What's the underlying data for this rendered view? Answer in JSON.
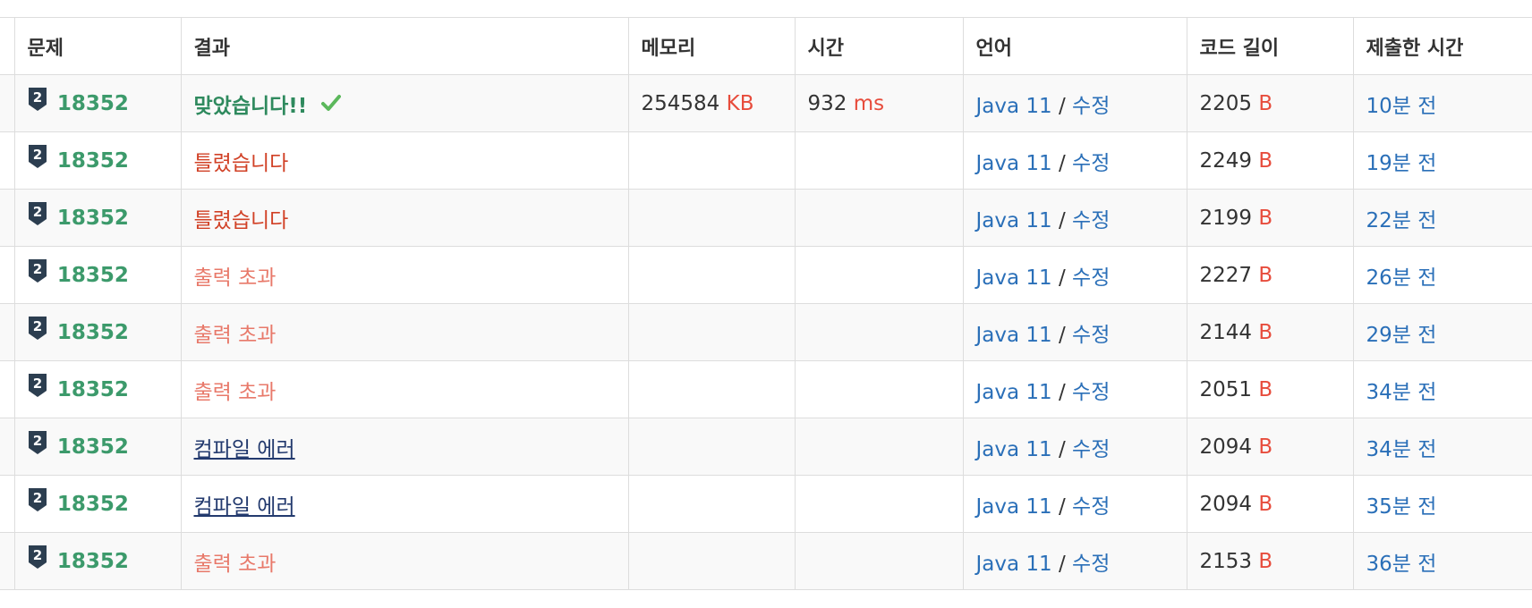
{
  "colors": {
    "ac": "#2f8a5e",
    "wa": "#d14126",
    "ole": "#e8796a",
    "ce": "#233a6e",
    "link": "#2a6fb8",
    "unit": "#e74c3c",
    "problem": "#3c9a6b",
    "tier_badge": "#2c3e50"
  },
  "headers": {
    "problem": "문제",
    "result": "결과",
    "memory": "메모리",
    "time": "시간",
    "language": "언어",
    "code_length": "코드 길이",
    "submitted": "제출한 시간"
  },
  "rows": [
    {
      "problem": "18352",
      "tier": "2",
      "result": "맞았습니다!!",
      "result_type": "ac",
      "memory": "254584",
      "memory_unit": "KB",
      "time": "932",
      "time_unit": "ms",
      "language": "Java 11",
      "slash": "/",
      "edit": "수정",
      "code_length": "2205",
      "code_unit": "B",
      "submitted": "10분 전"
    },
    {
      "problem": "18352",
      "tier": "2",
      "result": "틀렸습니다",
      "result_type": "wa",
      "memory": "",
      "memory_unit": "",
      "time": "",
      "time_unit": "",
      "language": "Java 11",
      "slash": "/",
      "edit": "수정",
      "code_length": "2249",
      "code_unit": "B",
      "submitted": "19분 전"
    },
    {
      "problem": "18352",
      "tier": "2",
      "result": "틀렸습니다",
      "result_type": "wa",
      "memory": "",
      "memory_unit": "",
      "time": "",
      "time_unit": "",
      "language": "Java 11",
      "slash": "/",
      "edit": "수정",
      "code_length": "2199",
      "code_unit": "B",
      "submitted": "22분 전"
    },
    {
      "problem": "18352",
      "tier": "2",
      "result": "출력 초과",
      "result_type": "ole",
      "memory": "",
      "memory_unit": "",
      "time": "",
      "time_unit": "",
      "language": "Java 11",
      "slash": "/",
      "edit": "수정",
      "code_length": "2227",
      "code_unit": "B",
      "submitted": "26분 전"
    },
    {
      "problem": "18352",
      "tier": "2",
      "result": "출력 초과",
      "result_type": "ole",
      "memory": "",
      "memory_unit": "",
      "time": "",
      "time_unit": "",
      "language": "Java 11",
      "slash": "/",
      "edit": "수정",
      "code_length": "2144",
      "code_unit": "B",
      "submitted": "29분 전"
    },
    {
      "problem": "18352",
      "tier": "2",
      "result": "출력 초과",
      "result_type": "ole",
      "memory": "",
      "memory_unit": "",
      "time": "",
      "time_unit": "",
      "language": "Java 11",
      "slash": "/",
      "edit": "수정",
      "code_length": "2051",
      "code_unit": "B",
      "submitted": "34분 전"
    },
    {
      "problem": "18352",
      "tier": "2",
      "result": "컴파일 에러",
      "result_type": "ce",
      "memory": "",
      "memory_unit": "",
      "time": "",
      "time_unit": "",
      "language": "Java 11",
      "slash": "/",
      "edit": "수정",
      "code_length": "2094",
      "code_unit": "B",
      "submitted": "34분 전"
    },
    {
      "problem": "18352",
      "tier": "2",
      "result": "컴파일 에러",
      "result_type": "ce",
      "memory": "",
      "memory_unit": "",
      "time": "",
      "time_unit": "",
      "language": "Java 11",
      "slash": "/",
      "edit": "수정",
      "code_length": "2094",
      "code_unit": "B",
      "submitted": "35분 전"
    },
    {
      "problem": "18352",
      "tier": "2",
      "result": "출력 초과",
      "result_type": "ole",
      "memory": "",
      "memory_unit": "",
      "time": "",
      "time_unit": "",
      "language": "Java 11",
      "slash": "/",
      "edit": "수정",
      "code_length": "2153",
      "code_unit": "B",
      "submitted": "36분 전"
    }
  ]
}
